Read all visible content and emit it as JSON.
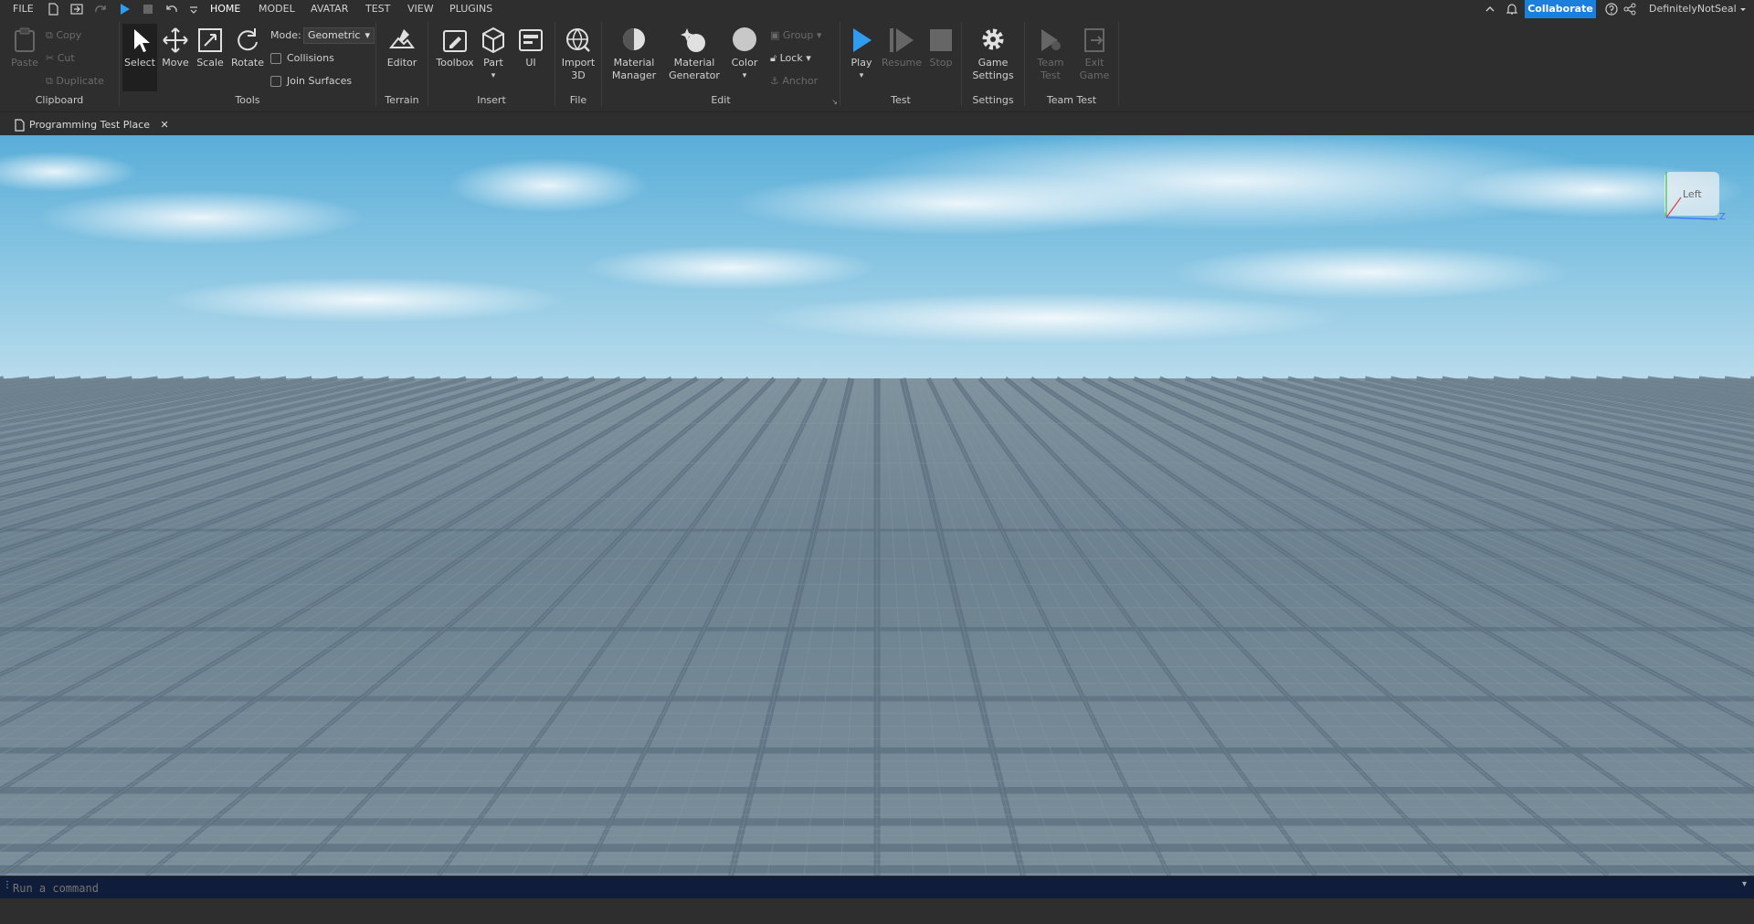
{
  "topbar": {
    "file_label": "FILE",
    "tabs": [
      {
        "label": "HOME"
      },
      {
        "label": "MODEL"
      },
      {
        "label": "AVATAR"
      },
      {
        "label": "TEST"
      },
      {
        "label": "VIEW"
      },
      {
        "label": "PLUGINS"
      }
    ],
    "collaborate_label": "Collaborate",
    "username": "DefinitelyNotSeal"
  },
  "ribbon": {
    "clipboard": {
      "paste": "Paste",
      "copy": "Copy",
      "cut": "Cut",
      "duplicate": "Duplicate",
      "group_label": "Clipboard"
    },
    "tools": {
      "select": "Select",
      "move": "Move",
      "scale": "Scale",
      "rotate": "Rotate",
      "mode_label": "Mode:",
      "mode_value": "Geometric",
      "collisions": "Collisions",
      "join_surfaces": "Join Surfaces",
      "group_label": "Tools"
    },
    "terrain": {
      "editor": "Editor",
      "group_label": "Terrain"
    },
    "insert": {
      "toolbox": "Toolbox",
      "part": "Part",
      "ui": "UI",
      "group_label": "Insert"
    },
    "file": {
      "import_line1": "Import",
      "import_line2": "3D",
      "group_label": "File"
    },
    "edit": {
      "material_manager_1": "Material",
      "material_manager_2": "Manager",
      "material_generator_1": "Material",
      "material_generator_2": "Generator",
      "color": "Color",
      "group": "Group",
      "lock": "Lock",
      "anchor": "Anchor",
      "group_label": "Edit"
    },
    "test": {
      "play": "Play",
      "resume": "Resume",
      "stop": "Stop",
      "group_label": "Test"
    },
    "settings": {
      "game_settings_1": "Game",
      "game_settings_2": "Settings",
      "group_label": "Settings"
    },
    "team_test": {
      "team_test_1": "Team",
      "team_test_2": "Test",
      "exit_game_1": "Exit",
      "exit_game_2": "Game",
      "group_label": "Team Test"
    }
  },
  "document": {
    "tab_title": "Programming Test Place"
  },
  "viewcube": {
    "face_label": "Left",
    "axis_z": "Z"
  },
  "command_bar": {
    "placeholder": "Run a command"
  },
  "colors": {
    "accent": "#1a80e0",
    "sky_top": "#4fa7d6",
    "ground": "#6f8492",
    "command_bg": "#0f1d3a"
  }
}
